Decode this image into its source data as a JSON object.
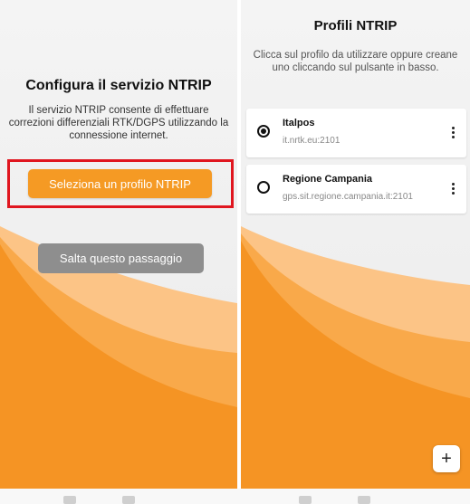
{
  "left_screen": {
    "title": "Configura il servizio NTRIP",
    "description": "Il servizio NTRIP consente di effettuare correzioni differenziali RTK/DGPS utilizzando la connessione internet.",
    "select_profile_button": "Seleziona un profilo NTRIP",
    "skip_button": "Salta questo passaggio"
  },
  "right_screen": {
    "title": "Profili NTRIP",
    "description": "Clicca sul profilo da utilizzare oppure creane uno cliccando sul pulsante in basso.",
    "profiles": [
      {
        "name": "Italpos",
        "host": "it.nrtk.eu:2101",
        "selected": true
      },
      {
        "name": "Regione Campania",
        "host": "gps.sit.regione.campania.it:2101",
        "selected": false
      }
    ],
    "add_button": "+"
  },
  "colors": {
    "accent_orange": "#f59a24",
    "highlight_red": "#e0161f",
    "skip_gray": "#8e8e8e"
  },
  "icons": {
    "radio_selected": "radio-selected-icon",
    "radio_unselected": "radio-unselected-icon",
    "more_options": "more-vert-icon",
    "add": "plus-icon"
  }
}
